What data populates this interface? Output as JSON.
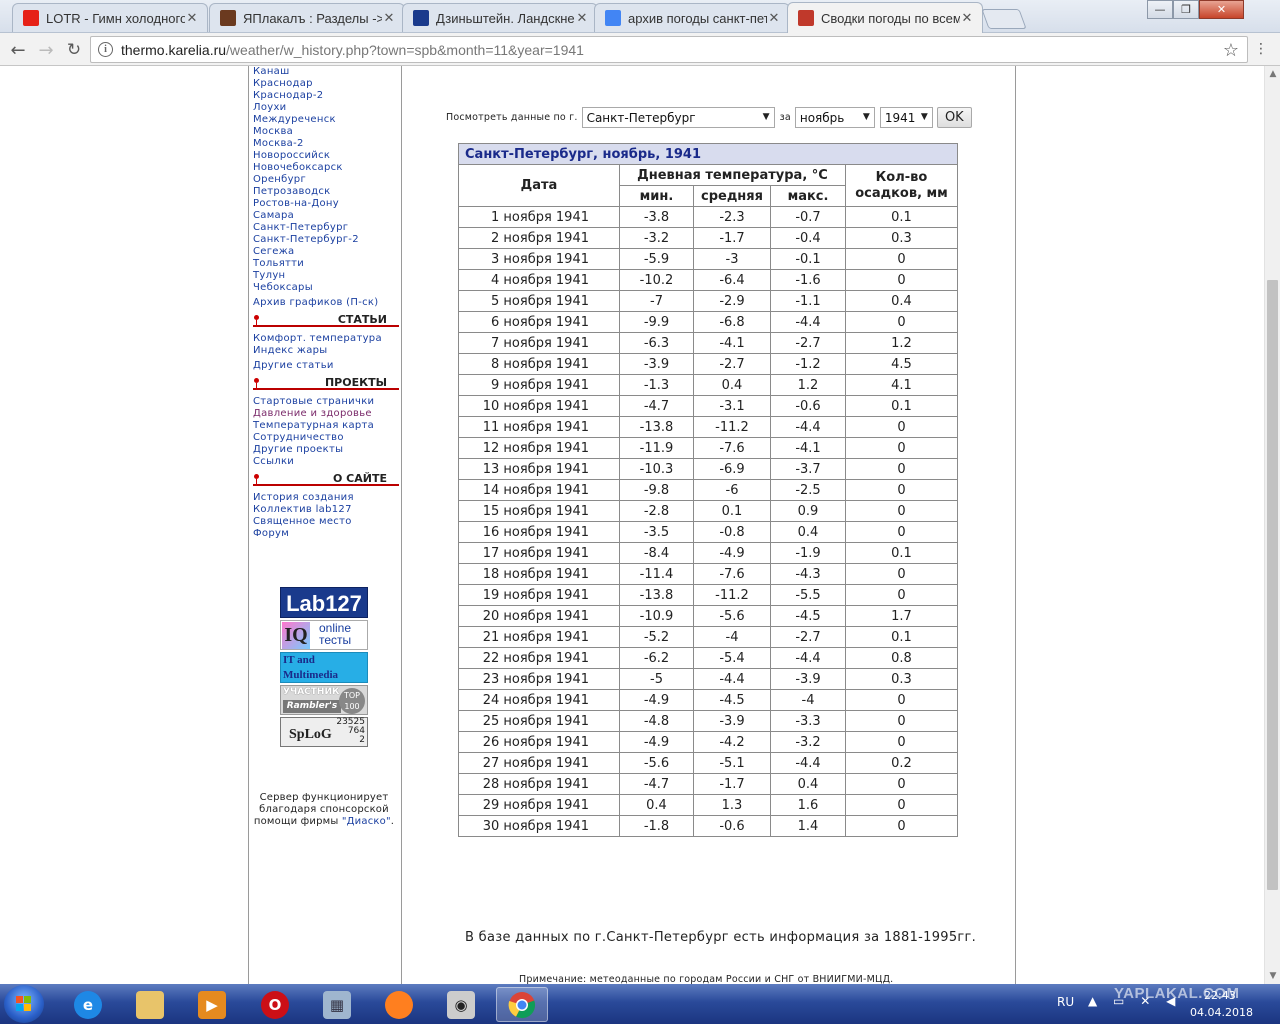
{
  "tabs": [
    {
      "title": "LOTR - Гимн холодного",
      "favicon": "youtube-icon",
      "color": "#e62117"
    },
    {
      "title": "ЯПлакалъ : Разделы ->",
      "favicon": "yaplakal-icon",
      "color": "#6b3a1f"
    },
    {
      "title": "Дзиньштейн. Ландскне",
      "favicon": "lib-ru-icon",
      "color": "#1a3a8c"
    },
    {
      "title": "архив погоды санкт-пет",
      "favicon": "google-icon",
      "color": "#4285f4"
    },
    {
      "title": "Сводки погоды по всем",
      "favicon": "thermometer-icon",
      "color": "#c0392b"
    }
  ],
  "window_controls": {
    "minimize": "—",
    "maximize": "❐",
    "close": "✕"
  },
  "address_bar": {
    "host": "thermo.karelia.ru",
    "path": "/weather/w_history.php?town=spb&month=11&year=1941"
  },
  "sidebar": {
    "cities": [
      "Канаш",
      "Краснодар",
      "Краснодар-2",
      "Лоухи",
      "Междуреченск",
      "Москва",
      "Москва-2",
      "Новороссийск",
      "Новочебоксарск",
      "Оренбург",
      "Петрозаводск",
      "Ростов-на-Дону",
      "Самара",
      "Санкт-Петербург",
      "Санкт-Петербург-2",
      "Сегежа",
      "Тольятти",
      "Тулун",
      "Чебоксары"
    ],
    "charts_archive": "Архив графиков (П-ск)",
    "sections": [
      {
        "title": "СТАТЬИ",
        "items": [
          "Комфорт. температура",
          "Индекс жары",
          "Другие статьи"
        ]
      },
      {
        "title": "ПРОЕКТЫ",
        "items": [
          "Стартовые странички",
          "Давление и здоровье",
          "Температурная карта",
          "Сотрудничество",
          "Другие проекты",
          "Ссылки"
        ]
      },
      {
        "title": "О САЙТЕ",
        "items": [
          "История создания",
          "Коллектив lab127",
          "Священное место",
          "Форум"
        ]
      }
    ],
    "badges": {
      "lab": "Lab127",
      "iq_mark": "IQ",
      "iq_line1": "online",
      "iq_line2": "тесты",
      "it_line1": "IT and",
      "it_line2": "Multimedia",
      "rambler_line1": "УЧАСТНИК",
      "rambler_line2": "Rambler's",
      "rambler_top1": "TOP",
      "rambler_top2": "100",
      "spylog_logo": "SpLoG",
      "spylog_n1": "23525",
      "spylog_n2": "764",
      "spylog_n3": "2"
    },
    "sponsor_text_1": "Сервер функционирует",
    "sponsor_text_2": "благодаря спонсорской",
    "sponsor_text_3": "помощи фирмы",
    "sponsor_link": "\"Диаско\"",
    "sponsor_dot": "."
  },
  "form": {
    "label": "Посмотреть данные по г.",
    "city": "Санкт-Петербург",
    "for_label": "за",
    "month": "ноябрь",
    "year": "1941",
    "ok": "OK"
  },
  "table": {
    "caption": "Санкт-Петербург, ноябрь, 1941",
    "col_date": "Дата",
    "col_temp_group": "Дневная температура, °С",
    "col_min": "мин.",
    "col_avg": "средняя",
    "col_max": "макс.",
    "col_precip_1": "Кол-во",
    "col_precip_2": "осадков, мм",
    "rows": [
      [
        "1 ноября 1941",
        "-3.8",
        "-2.3",
        "-0.7",
        "0.1"
      ],
      [
        "2 ноября 1941",
        "-3.2",
        "-1.7",
        "-0.4",
        "0.3"
      ],
      [
        "3 ноября 1941",
        "-5.9",
        "-3",
        "-0.1",
        "0"
      ],
      [
        "4 ноября 1941",
        "-10.2",
        "-6.4",
        "-1.6",
        "0"
      ],
      [
        "5 ноября 1941",
        "-7",
        "-2.9",
        "-1.1",
        "0.4"
      ],
      [
        "6 ноября 1941",
        "-9.9",
        "-6.8",
        "-4.4",
        "0"
      ],
      [
        "7 ноября 1941",
        "-6.3",
        "-4.1",
        "-2.7",
        "1.2"
      ],
      [
        "8 ноября 1941",
        "-3.9",
        "-2.7",
        "-1.2",
        "4.5"
      ],
      [
        "9 ноября 1941",
        "-1.3",
        "0.4",
        "1.2",
        "4.1"
      ],
      [
        "10 ноября 1941",
        "-4.7",
        "-3.1",
        "-0.6",
        "0.1"
      ],
      [
        "11 ноября 1941",
        "-13.8",
        "-11.2",
        "-4.4",
        "0"
      ],
      [
        "12 ноября 1941",
        "-11.9",
        "-7.6",
        "-4.1",
        "0"
      ],
      [
        "13 ноября 1941",
        "-10.3",
        "-6.9",
        "-3.7",
        "0"
      ],
      [
        "14 ноября 1941",
        "-9.8",
        "-6",
        "-2.5",
        "0"
      ],
      [
        "15 ноября 1941",
        "-2.8",
        "0.1",
        "0.9",
        "0"
      ],
      [
        "16 ноября 1941",
        "-3.5",
        "-0.8",
        "0.4",
        "0"
      ],
      [
        "17 ноября 1941",
        "-8.4",
        "-4.9",
        "-1.9",
        "0.1"
      ],
      [
        "18 ноября 1941",
        "-11.4",
        "-7.6",
        "-4.3",
        "0"
      ],
      [
        "19 ноября 1941",
        "-13.8",
        "-11.2",
        "-5.5",
        "0"
      ],
      [
        "20 ноября 1941",
        "-10.9",
        "-5.6",
        "-4.5",
        "1.7"
      ],
      [
        "21 ноября 1941",
        "-5.2",
        "-4",
        "-2.7",
        "0.1"
      ],
      [
        "22 ноября 1941",
        "-6.2",
        "-5.4",
        "-4.4",
        "0.8"
      ],
      [
        "23 ноября 1941",
        "-5",
        "-4.4",
        "-3.9",
        "0.3"
      ],
      [
        "24 ноября 1941",
        "-4.9",
        "-4.5",
        "-4",
        "0"
      ],
      [
        "25 ноября 1941",
        "-4.8",
        "-3.9",
        "-3.3",
        "0"
      ],
      [
        "26 ноября 1941",
        "-4.9",
        "-4.2",
        "-3.2",
        "0"
      ],
      [
        "27 ноября 1941",
        "-5.6",
        "-5.1",
        "-4.4",
        "0.2"
      ],
      [
        "28 ноября 1941",
        "-4.7",
        "-1.7",
        "0.4",
        "0"
      ],
      [
        "29 ноября 1941",
        "0.4",
        "1.3",
        "1.6",
        "0"
      ],
      [
        "30 ноября 1941",
        "-1.8",
        "-0.6",
        "1.4",
        "0"
      ]
    ]
  },
  "footer": {
    "note": "В базе данных по г.Санкт-Петербург есть информация за 1881-1995гг.",
    "source": "Примечание: метеоданные по городам России и СНГ от ВНИИГМИ-МЦД."
  },
  "taskbar": {
    "apps": [
      "internet-explorer-icon",
      "file-explorer-icon",
      "media-player-icon",
      "opera-icon",
      "calculator-icon",
      "firefox-icon",
      "eye-app-icon",
      "chrome-icon"
    ],
    "lang": "RU",
    "time": "22:43",
    "date": "04.04.2018",
    "watermark": "YAPLAKAL.COM"
  }
}
